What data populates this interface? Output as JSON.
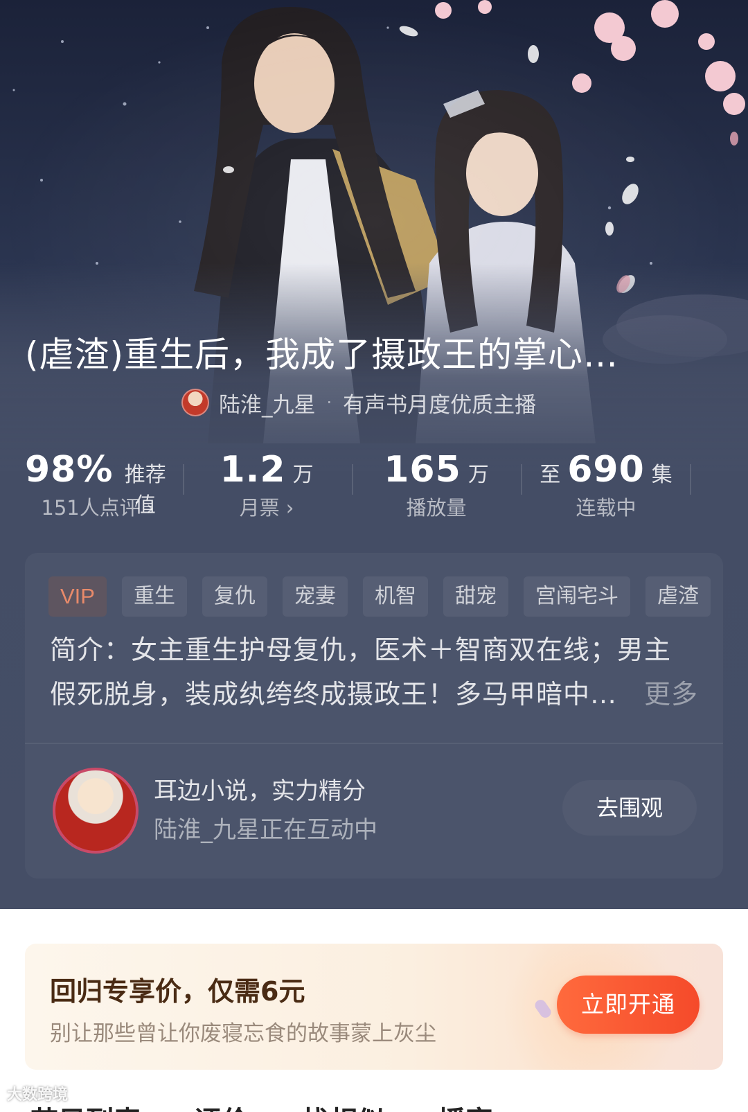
{
  "book": {
    "title": "(虐渣)重生后，我成了摄政王的掌心…",
    "anchor_name": "陆淮_九星",
    "anchor_badge": "有声书月度优质主播"
  },
  "stats": [
    {
      "prefix": "",
      "value": "98%",
      "unit": "推荐值",
      "sub": "151人点评 ›"
    },
    {
      "prefix": "",
      "value": "1.2",
      "unit": "万",
      "sub": "月票 ›"
    },
    {
      "prefix": "",
      "value": "165",
      "unit": "万",
      "sub": "播放量"
    },
    {
      "prefix": "至",
      "value": "690",
      "unit": "集",
      "sub": "连载中"
    }
  ],
  "tags": [
    "VIP",
    "重生",
    "复仇",
    "宠妻",
    "机智",
    "甜宠",
    "宫闱宅斗",
    "虐渣"
  ],
  "intro": {
    "line1": "简介：女主重生护母复仇，医术＋智商双在线；男主",
    "line2": "假死脱身，装成纨绔终成摄政王！多马甲暗中…",
    "more": "更多"
  },
  "interaction": {
    "title": "耳边小说，实力精分",
    "subtitle": "陆淮_九星正在互动中",
    "button": "去围观"
  },
  "promo": {
    "title": "回归专享价，仅需6元",
    "subtitle": "别让那些曾让你废寝忘食的故事蒙上灰尘",
    "button": "立即开通"
  },
  "bottom_tabs": [
    "节目列表",
    "评价",
    "找相似",
    "播客"
  ],
  "watermark": "大数跨境",
  "colors": {
    "hero_bg": "#454e66",
    "card_bg": "#4b546b",
    "vip_text": "#e88a6a",
    "promo_button": "#f54a2a",
    "promo_title": "#4a2b14"
  }
}
